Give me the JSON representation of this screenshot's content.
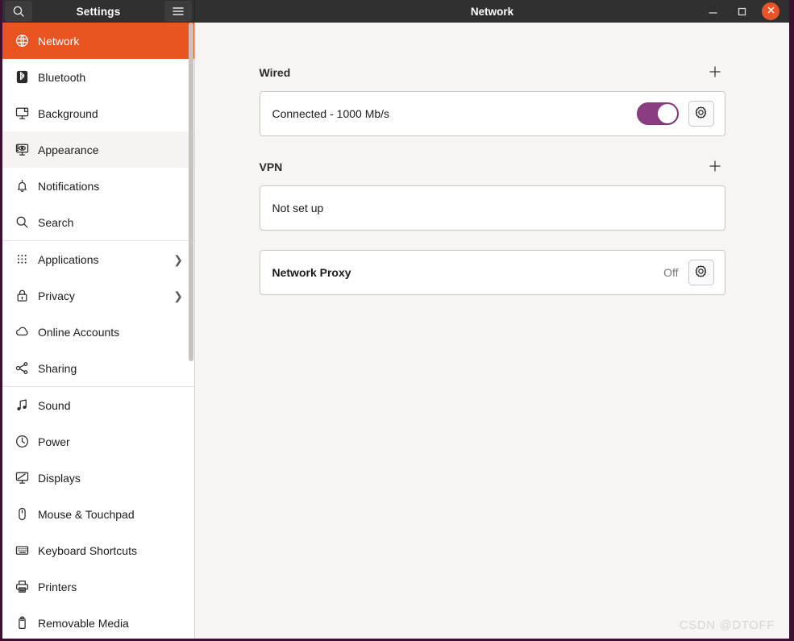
{
  "titlebar": {
    "search_icon": "search-icon",
    "left_title": "Settings",
    "menu_icon": "hamburger-menu-icon",
    "main_title": "Network",
    "minimize_label": "–",
    "maximize_label": "□",
    "close_label": "✕"
  },
  "sidebar": {
    "items": [
      {
        "label": "Network",
        "icon": "globe-icon",
        "selected": true,
        "hover": false,
        "chevron": false,
        "sep_after": false
      },
      {
        "label": "Bluetooth",
        "icon": "bluetooth-icon",
        "selected": false,
        "hover": false,
        "chevron": false,
        "sep_after": false
      },
      {
        "label": "Background",
        "icon": "background-icon",
        "selected": false,
        "hover": false,
        "chevron": false,
        "sep_after": false
      },
      {
        "label": "Appearance",
        "icon": "appearance-icon",
        "selected": false,
        "hover": true,
        "chevron": false,
        "sep_after": false
      },
      {
        "label": "Notifications",
        "icon": "bell-icon",
        "selected": false,
        "hover": false,
        "chevron": false,
        "sep_after": false
      },
      {
        "label": "Search",
        "icon": "search-icon",
        "selected": false,
        "hover": false,
        "chevron": false,
        "sep_after": true
      },
      {
        "label": "Applications",
        "icon": "apps-grid-icon",
        "selected": false,
        "hover": false,
        "chevron": true,
        "sep_after": false
      },
      {
        "label": "Privacy",
        "icon": "lock-icon",
        "selected": false,
        "hover": false,
        "chevron": true,
        "sep_after": false
      },
      {
        "label": "Online Accounts",
        "icon": "cloud-icon",
        "selected": false,
        "hover": false,
        "chevron": false,
        "sep_after": false
      },
      {
        "label": "Sharing",
        "icon": "share-icon",
        "selected": false,
        "hover": false,
        "chevron": false,
        "sep_after": true
      },
      {
        "label": "Sound",
        "icon": "music-note-icon",
        "selected": false,
        "hover": false,
        "chevron": false,
        "sep_after": false
      },
      {
        "label": "Power",
        "icon": "power-icon",
        "selected": false,
        "hover": false,
        "chevron": false,
        "sep_after": false
      },
      {
        "label": "Displays",
        "icon": "display-icon",
        "selected": false,
        "hover": false,
        "chevron": false,
        "sep_after": false
      },
      {
        "label": "Mouse & Touchpad",
        "icon": "mouse-icon",
        "selected": false,
        "hover": false,
        "chevron": false,
        "sep_after": false
      },
      {
        "label": "Keyboard Shortcuts",
        "icon": "keyboard-icon",
        "selected": false,
        "hover": false,
        "chevron": false,
        "sep_after": false
      },
      {
        "label": "Printers",
        "icon": "printer-icon",
        "selected": false,
        "hover": false,
        "chevron": false,
        "sep_after": false
      },
      {
        "label": "Removable Media",
        "icon": "removable-media-icon",
        "selected": false,
        "hover": false,
        "chevron": false,
        "sep_after": false
      }
    ],
    "chevron_glyph": "❯"
  },
  "main": {
    "wired": {
      "title": "Wired",
      "add_label": "+",
      "connection_status": "Connected - 1000 Mb/s",
      "toggle_on": true,
      "settings_icon": "gear-icon"
    },
    "vpn": {
      "title": "VPN",
      "add_label": "+",
      "status": "Not set up"
    },
    "proxy": {
      "label": "Network Proxy",
      "value": "Off",
      "settings_icon": "gear-icon"
    }
  },
  "watermark": "CSDN @DTOFF",
  "colors": {
    "accent_orange": "#e95420",
    "toggle_purple": "#8b3d82",
    "titlebar": "#303030",
    "content_bg": "#f6f5f4",
    "close_button": "#e8542a",
    "window_border": "#3b1030"
  }
}
